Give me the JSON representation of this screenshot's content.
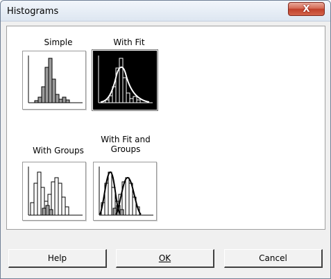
{
  "window": {
    "title": "Histograms",
    "close_glyph": "X"
  },
  "gallery": [
    {
      "label": "Simple",
      "selected": false
    },
    {
      "label": "With Fit",
      "selected": true
    },
    {
      "label": "With Groups",
      "selected": false
    },
    {
      "label": "With Fit and Groups",
      "selected": false
    }
  ],
  "buttons": {
    "help": "Help",
    "ok": "OK",
    "cancel": "Cancel"
  },
  "colors": {
    "selected_bg": "#000000",
    "dialog_bg": "#f0f0f0",
    "close_red": "#c0402a"
  }
}
